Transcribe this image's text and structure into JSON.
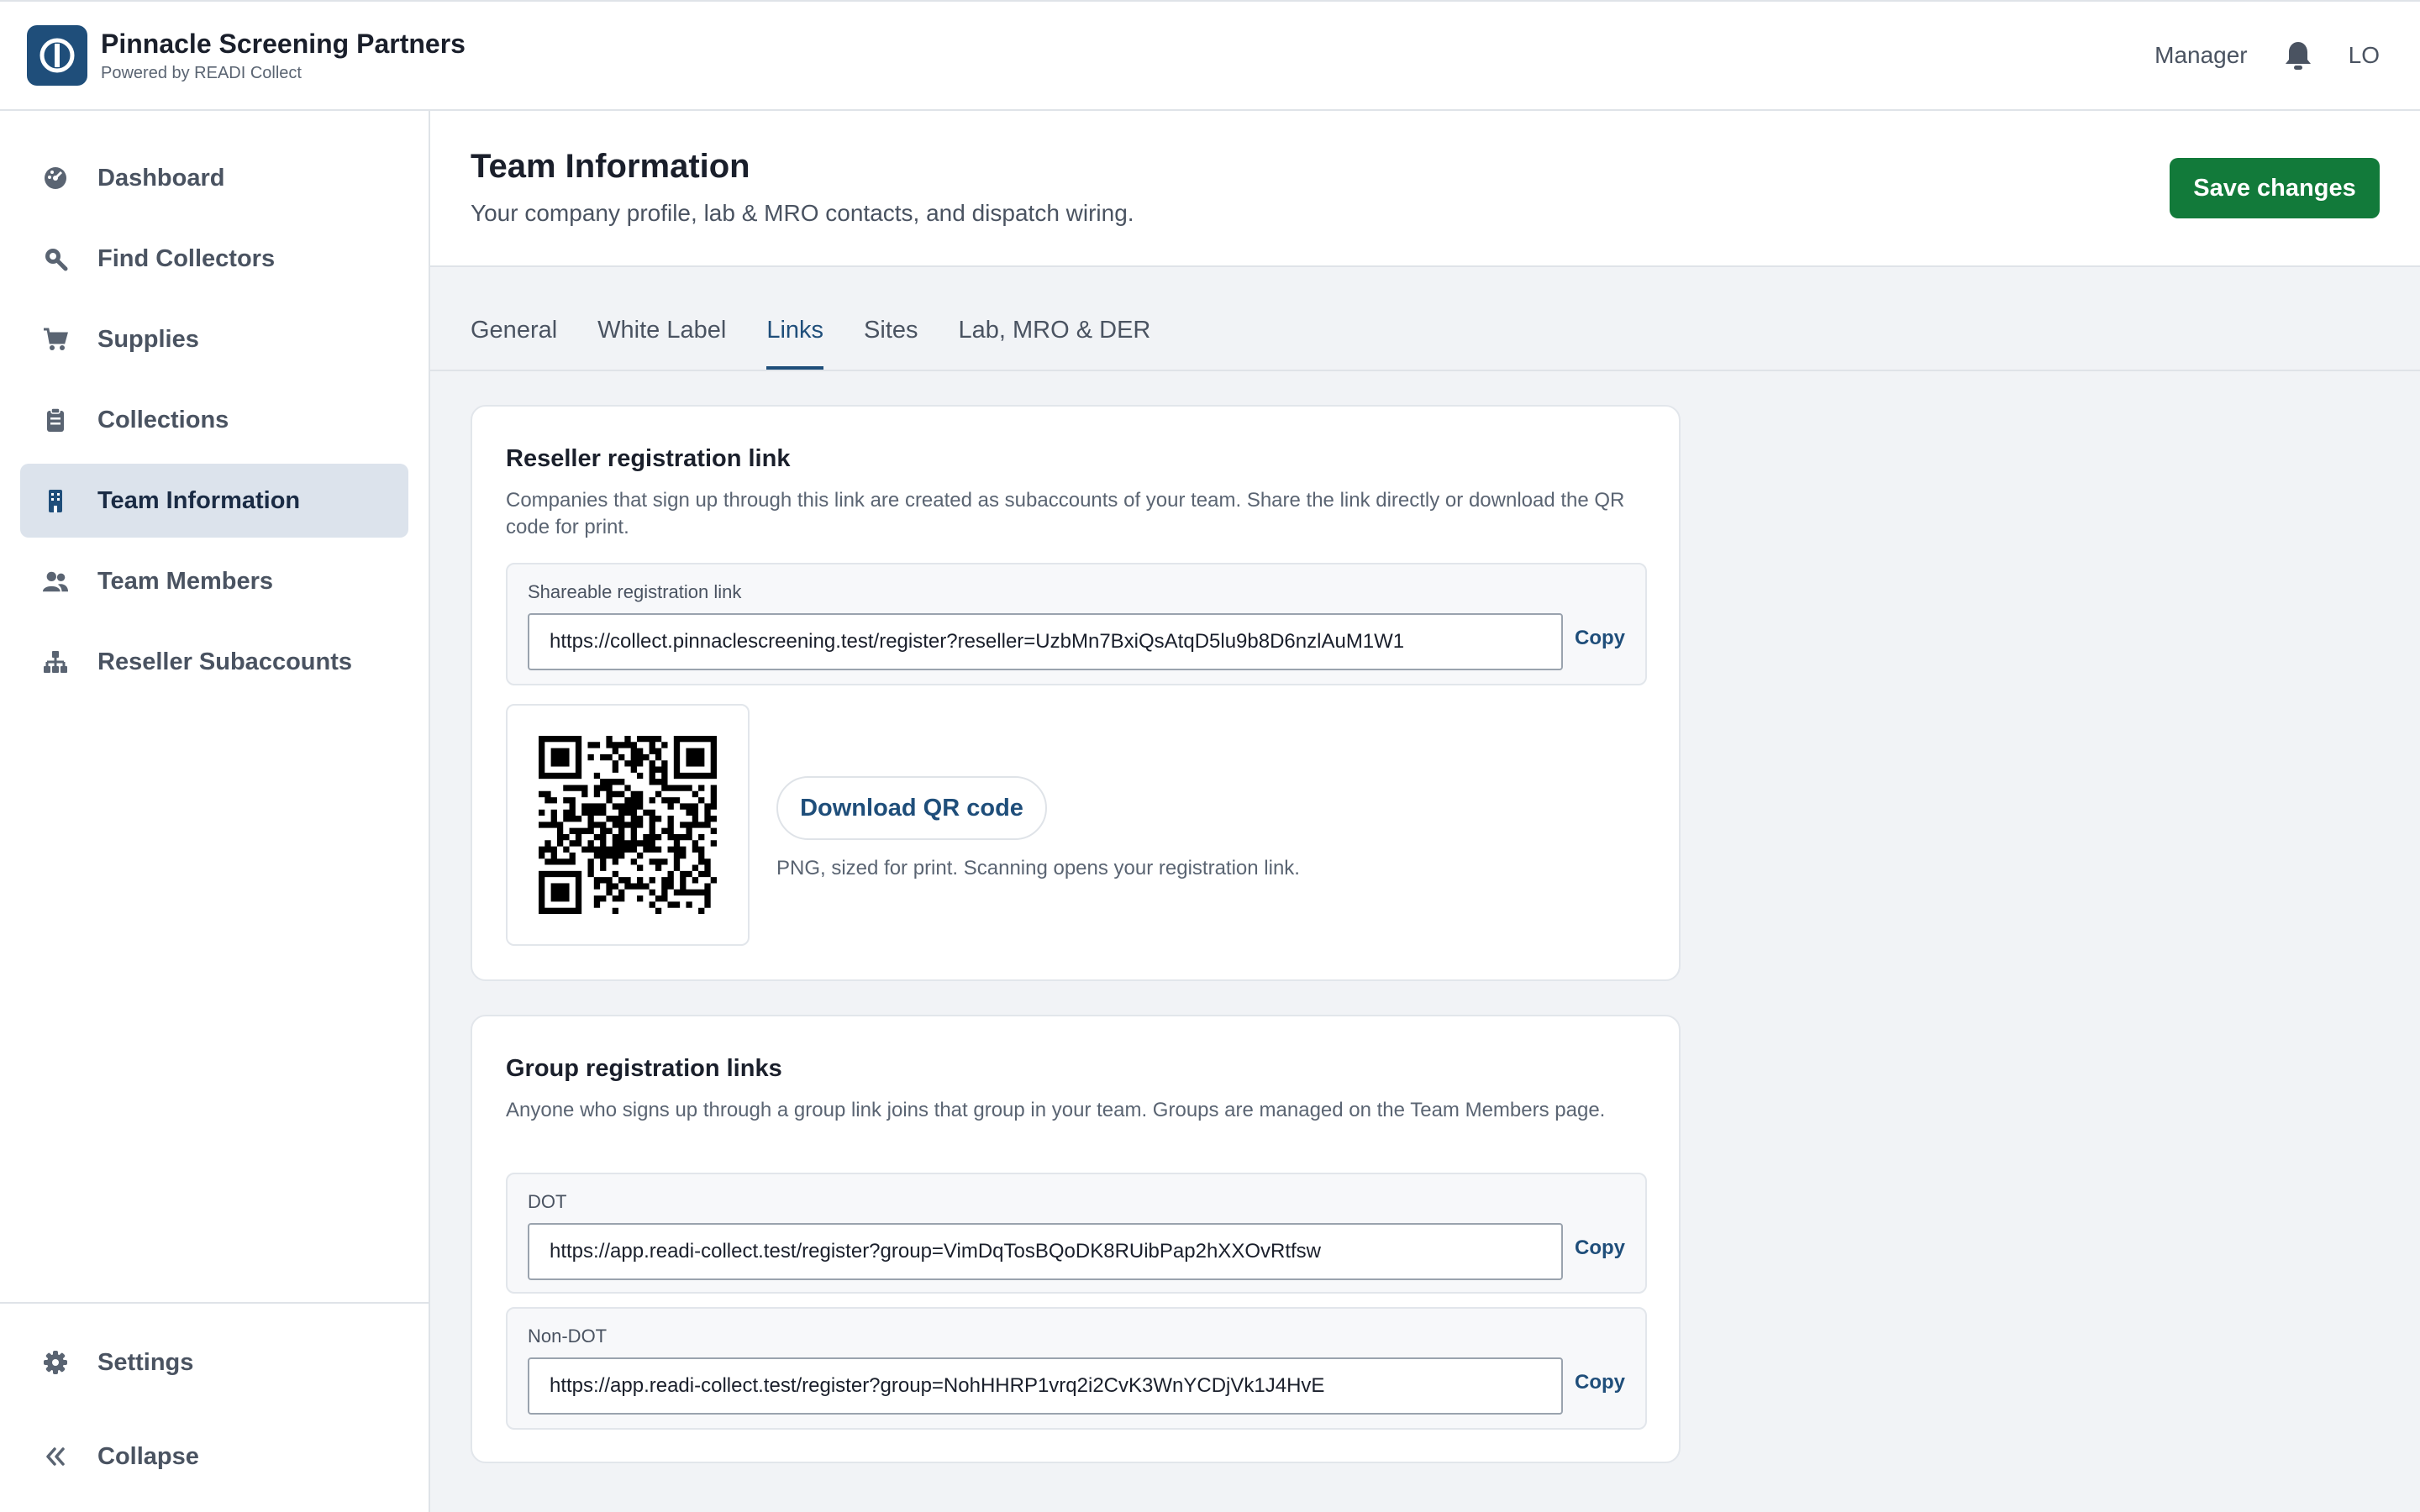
{
  "brand": {
    "name": "Pinnacle Screening Partners",
    "subtitle": "Powered by READI Collect"
  },
  "topbar": {
    "role": "Manager",
    "initials": "LO"
  },
  "sidebar": {
    "items": [
      {
        "label": "Dashboard",
        "icon": "dashboard-icon"
      },
      {
        "label": "Find Collectors",
        "icon": "search-icon"
      },
      {
        "label": "Supplies",
        "icon": "cart-icon"
      },
      {
        "label": "Collections",
        "icon": "clipboard-icon"
      },
      {
        "label": "Team Information",
        "icon": "building-icon",
        "active": true
      },
      {
        "label": "Team Members",
        "icon": "users-icon"
      },
      {
        "label": "Reseller Subaccounts",
        "icon": "hierarchy-icon"
      }
    ],
    "settings_label": "Settings",
    "collapse_label": "Collapse"
  },
  "header": {
    "title": "Team Information",
    "subtitle": "Your company profile, lab & MRO contacts, and dispatch wiring.",
    "save_label": "Save changes"
  },
  "tabs": [
    "General",
    "White Label",
    "Links",
    "Sites",
    "Lab, MRO & DER"
  ],
  "active_tab": "Links",
  "reseller": {
    "title": "Reseller registration link",
    "description": "Companies that sign up through this link are created as subaccounts of your team. Share the link directly or download the QR code for print.",
    "link_label": "Shareable registration link",
    "link_value": "https://collect.pinnaclescreening.test/register?reseller=UzbMn7BxiQsAtqD5lu9b8D6nzlAuM1W1",
    "copy_label": "Copy",
    "download_label": "Download QR code",
    "qr_note": "PNG, sized for print. Scanning opens your registration link."
  },
  "groups": {
    "title": "Group registration links",
    "description": "Anyone who signs up through a group link joins that group in your team. Groups are managed on the Team Members page.",
    "links": [
      {
        "label": "DOT",
        "value": "https://app.readi-collect.test/register?group=VimDqTosBQoDK8RUibPap2hXXOvRtfsw",
        "copy_label": "Copy"
      },
      {
        "label": "Non-DOT",
        "value": "https://app.readi-collect.test/register?group=NohHHRP1vrq2i2CvK3WnYCDjVk1J4HvE",
        "copy_label": "Copy"
      }
    ]
  },
  "colors": {
    "primary": "#1f4e7a",
    "save_button": "#127a3a",
    "active_nav_bg": "#dce3ec",
    "page_bg": "#f1f3f6"
  }
}
